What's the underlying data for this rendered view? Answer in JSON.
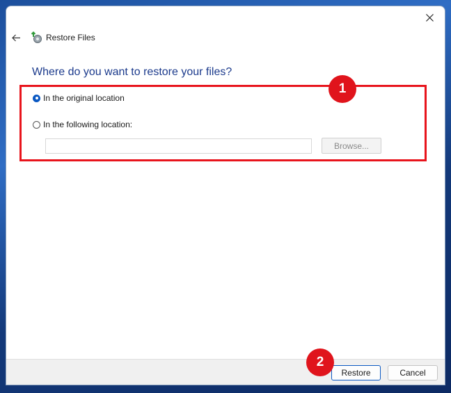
{
  "window": {
    "title": "Restore Files",
    "icons": {
      "close": "close-icon",
      "back": "back-arrow-icon",
      "app": "restore-files-icon"
    }
  },
  "content": {
    "heading": "Where do you want to restore your files?",
    "options": [
      {
        "label": "In the original location",
        "checked": true
      },
      {
        "label": "In the following location:",
        "checked": false
      }
    ],
    "path_input": {
      "value": "",
      "placeholder": ""
    },
    "browse_label": "Browse..."
  },
  "annotations": {
    "badge_1": "1",
    "badge_2": "2",
    "color": "#e8141c"
  },
  "footer": {
    "restore_label": "Restore",
    "cancel_label": "Cancel"
  },
  "colors": {
    "heading": "#1b3a8c",
    "accent": "#0a58c2"
  }
}
